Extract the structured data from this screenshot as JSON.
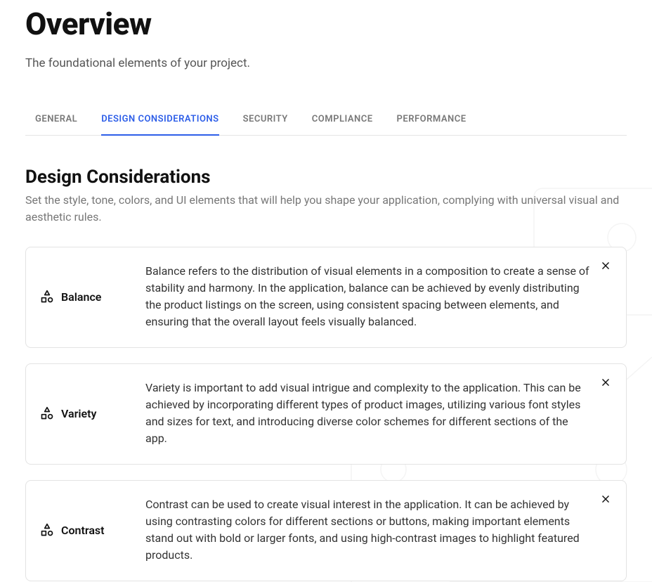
{
  "page": {
    "title": "Overview",
    "subtitle": "The foundational elements of your project."
  },
  "tabs": [
    {
      "label": "GENERAL",
      "active": false
    },
    {
      "label": "DESIGN CONSIDERATIONS",
      "active": true
    },
    {
      "label": "SECURITY",
      "active": false
    },
    {
      "label": "COMPLIANCE",
      "active": false
    },
    {
      "label": "PERFORMANCE",
      "active": false
    }
  ],
  "section": {
    "title": "Design Considerations",
    "description": "Set the style, tone, colors, and UI elements that will help you shape your application, complying with universal visual and aesthetic rules."
  },
  "cards": [
    {
      "icon": "shapes-icon",
      "label": "Balance",
      "body": "Balance refers to the distribution of visual elements in a composition to create a sense of stability and harmony. In the application, balance can be achieved by evenly distributing the product listings on the screen, using consistent spacing between elements, and ensuring that the overall layout feels visually balanced."
    },
    {
      "icon": "shapes-icon",
      "label": "Variety",
      "body": "Variety is important to add visual intrigue and complexity to the application. This can be achieved by incorporating different types of product images, utilizing various font styles and sizes for text, and introducing diverse color schemes for different sections of the app."
    },
    {
      "icon": "shapes-icon",
      "label": "Contrast",
      "body": "Contrast can be used to create visual interest in the application. It can be achieved by using contrasting colors for different sections or buttons, making important elements stand out with bold or larger fonts, and using high-contrast images to highlight featured products."
    }
  ]
}
